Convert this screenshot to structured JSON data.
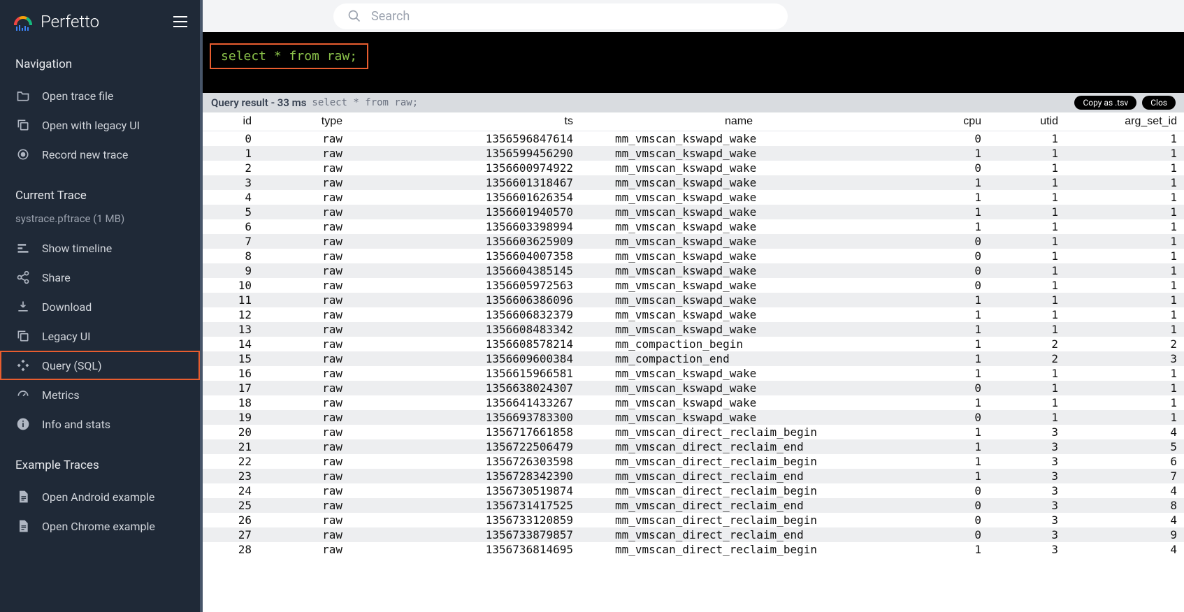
{
  "brand": "Perfetto",
  "search_placeholder": "Search",
  "sql_query": "select * from raw;",
  "result_header": {
    "label": "Query result - 33 ms",
    "echo": "select * from raw;",
    "copy_btn": "Copy as .tsv",
    "close_btn": "Clos"
  },
  "sidebar": {
    "navigation": {
      "title": "Navigation",
      "items": [
        {
          "label": "Open trace file",
          "icon": "folder"
        },
        {
          "label": "Open with legacy UI",
          "icon": "copy"
        },
        {
          "label": "Record new trace",
          "icon": "record"
        }
      ]
    },
    "current_trace": {
      "title": "Current Trace",
      "subtitle": "systrace.pftrace (1 MB)",
      "items": [
        {
          "label": "Show timeline",
          "icon": "timeline"
        },
        {
          "label": "Share",
          "icon": "share"
        },
        {
          "label": "Download",
          "icon": "download"
        },
        {
          "label": "Legacy UI",
          "icon": "copy"
        },
        {
          "label": "Query (SQL)",
          "icon": "query",
          "highlighted": true
        },
        {
          "label": "Metrics",
          "icon": "speed"
        },
        {
          "label": "Info and stats",
          "icon": "info"
        }
      ]
    },
    "examples": {
      "title": "Example Traces",
      "items": [
        {
          "label": "Open Android example",
          "icon": "file"
        },
        {
          "label": "Open Chrome example",
          "icon": "file"
        }
      ]
    }
  },
  "columns": [
    "id",
    "type",
    "ts",
    "name",
    "cpu",
    "utid",
    "arg_set_id"
  ],
  "rows": [
    {
      "id": 0,
      "type": "raw",
      "ts": "1356596847614",
      "name": "mm_vmscan_kswapd_wake",
      "cpu": 0,
      "utid": 1,
      "arg_set_id": 1
    },
    {
      "id": 1,
      "type": "raw",
      "ts": "1356599456290",
      "name": "mm_vmscan_kswapd_wake",
      "cpu": 1,
      "utid": 1,
      "arg_set_id": 1
    },
    {
      "id": 2,
      "type": "raw",
      "ts": "1356600974922",
      "name": "mm_vmscan_kswapd_wake",
      "cpu": 0,
      "utid": 1,
      "arg_set_id": 1
    },
    {
      "id": 3,
      "type": "raw",
      "ts": "1356601318467",
      "name": "mm_vmscan_kswapd_wake",
      "cpu": 1,
      "utid": 1,
      "arg_set_id": 1
    },
    {
      "id": 4,
      "type": "raw",
      "ts": "1356601626354",
      "name": "mm_vmscan_kswapd_wake",
      "cpu": 1,
      "utid": 1,
      "arg_set_id": 1
    },
    {
      "id": 5,
      "type": "raw",
      "ts": "1356601940570",
      "name": "mm_vmscan_kswapd_wake",
      "cpu": 1,
      "utid": 1,
      "arg_set_id": 1
    },
    {
      "id": 6,
      "type": "raw",
      "ts": "1356603398994",
      "name": "mm_vmscan_kswapd_wake",
      "cpu": 1,
      "utid": 1,
      "arg_set_id": 1
    },
    {
      "id": 7,
      "type": "raw",
      "ts": "1356603625909",
      "name": "mm_vmscan_kswapd_wake",
      "cpu": 0,
      "utid": 1,
      "arg_set_id": 1
    },
    {
      "id": 8,
      "type": "raw",
      "ts": "1356604007358",
      "name": "mm_vmscan_kswapd_wake",
      "cpu": 0,
      "utid": 1,
      "arg_set_id": 1
    },
    {
      "id": 9,
      "type": "raw",
      "ts": "1356604385145",
      "name": "mm_vmscan_kswapd_wake",
      "cpu": 0,
      "utid": 1,
      "arg_set_id": 1
    },
    {
      "id": 10,
      "type": "raw",
      "ts": "1356605972563",
      "name": "mm_vmscan_kswapd_wake",
      "cpu": 0,
      "utid": 1,
      "arg_set_id": 1
    },
    {
      "id": 11,
      "type": "raw",
      "ts": "1356606386096",
      "name": "mm_vmscan_kswapd_wake",
      "cpu": 1,
      "utid": 1,
      "arg_set_id": 1
    },
    {
      "id": 12,
      "type": "raw",
      "ts": "1356606832379",
      "name": "mm_vmscan_kswapd_wake",
      "cpu": 1,
      "utid": 1,
      "arg_set_id": 1
    },
    {
      "id": 13,
      "type": "raw",
      "ts": "1356608483342",
      "name": "mm_vmscan_kswapd_wake",
      "cpu": 1,
      "utid": 1,
      "arg_set_id": 1
    },
    {
      "id": 14,
      "type": "raw",
      "ts": "1356608578214",
      "name": "mm_compaction_begin",
      "cpu": 1,
      "utid": 2,
      "arg_set_id": 2
    },
    {
      "id": 15,
      "type": "raw",
      "ts": "1356609600384",
      "name": "mm_compaction_end",
      "cpu": 1,
      "utid": 2,
      "arg_set_id": 3
    },
    {
      "id": 16,
      "type": "raw",
      "ts": "1356615966581",
      "name": "mm_vmscan_kswapd_wake",
      "cpu": 1,
      "utid": 1,
      "arg_set_id": 1
    },
    {
      "id": 17,
      "type": "raw",
      "ts": "1356638024307",
      "name": "mm_vmscan_kswapd_wake",
      "cpu": 0,
      "utid": 1,
      "arg_set_id": 1
    },
    {
      "id": 18,
      "type": "raw",
      "ts": "1356641433267",
      "name": "mm_vmscan_kswapd_wake",
      "cpu": 1,
      "utid": 1,
      "arg_set_id": 1
    },
    {
      "id": 19,
      "type": "raw",
      "ts": "1356693783300",
      "name": "mm_vmscan_kswapd_wake",
      "cpu": 0,
      "utid": 1,
      "arg_set_id": 1
    },
    {
      "id": 20,
      "type": "raw",
      "ts": "1356717661858",
      "name": "mm_vmscan_direct_reclaim_begin",
      "cpu": 1,
      "utid": 3,
      "arg_set_id": 4
    },
    {
      "id": 21,
      "type": "raw",
      "ts": "1356722506479",
      "name": "mm_vmscan_direct_reclaim_end",
      "cpu": 1,
      "utid": 3,
      "arg_set_id": 5
    },
    {
      "id": 22,
      "type": "raw",
      "ts": "1356726303598",
      "name": "mm_vmscan_direct_reclaim_begin",
      "cpu": 1,
      "utid": 3,
      "arg_set_id": 6
    },
    {
      "id": 23,
      "type": "raw",
      "ts": "1356728342390",
      "name": "mm_vmscan_direct_reclaim_end",
      "cpu": 1,
      "utid": 3,
      "arg_set_id": 7
    },
    {
      "id": 24,
      "type": "raw",
      "ts": "1356730519874",
      "name": "mm_vmscan_direct_reclaim_begin",
      "cpu": 0,
      "utid": 3,
      "arg_set_id": 4
    },
    {
      "id": 25,
      "type": "raw",
      "ts": "1356731417525",
      "name": "mm_vmscan_direct_reclaim_end",
      "cpu": 0,
      "utid": 3,
      "arg_set_id": 8
    },
    {
      "id": 26,
      "type": "raw",
      "ts": "1356733120859",
      "name": "mm_vmscan_direct_reclaim_begin",
      "cpu": 0,
      "utid": 3,
      "arg_set_id": 4
    },
    {
      "id": 27,
      "type": "raw",
      "ts": "1356733879857",
      "name": "mm_vmscan_direct_reclaim_end",
      "cpu": 0,
      "utid": 3,
      "arg_set_id": 9
    },
    {
      "id": 28,
      "type": "raw",
      "ts": "1356736814695",
      "name": "mm_vmscan_direct_reclaim_begin",
      "cpu": 1,
      "utid": 3,
      "arg_set_id": 4
    }
  ]
}
